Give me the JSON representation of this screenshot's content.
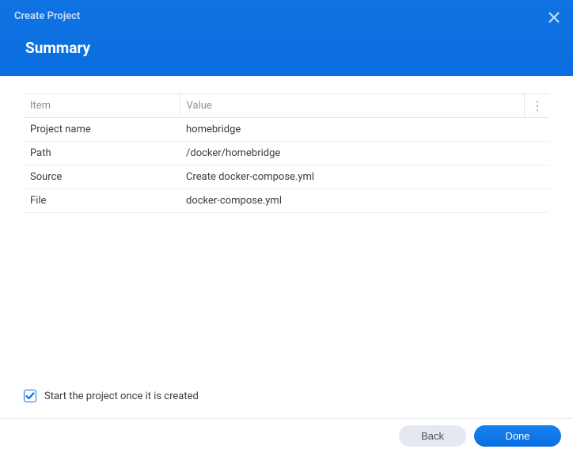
{
  "header": {
    "title": "Create Project",
    "subtitle": "Summary"
  },
  "table": {
    "col_item": "Item",
    "col_value": "Value",
    "rows": [
      {
        "item": "Project name",
        "value": "homebridge"
      },
      {
        "item": "Path",
        "value": "/docker/homebridge"
      },
      {
        "item": "Source",
        "value": "Create docker-compose.yml"
      },
      {
        "item": "File",
        "value": "docker-compose.yml"
      }
    ]
  },
  "checkbox": {
    "label": "Start the project once it is created",
    "checked": true
  },
  "buttons": {
    "back": "Back",
    "done": "Done"
  }
}
